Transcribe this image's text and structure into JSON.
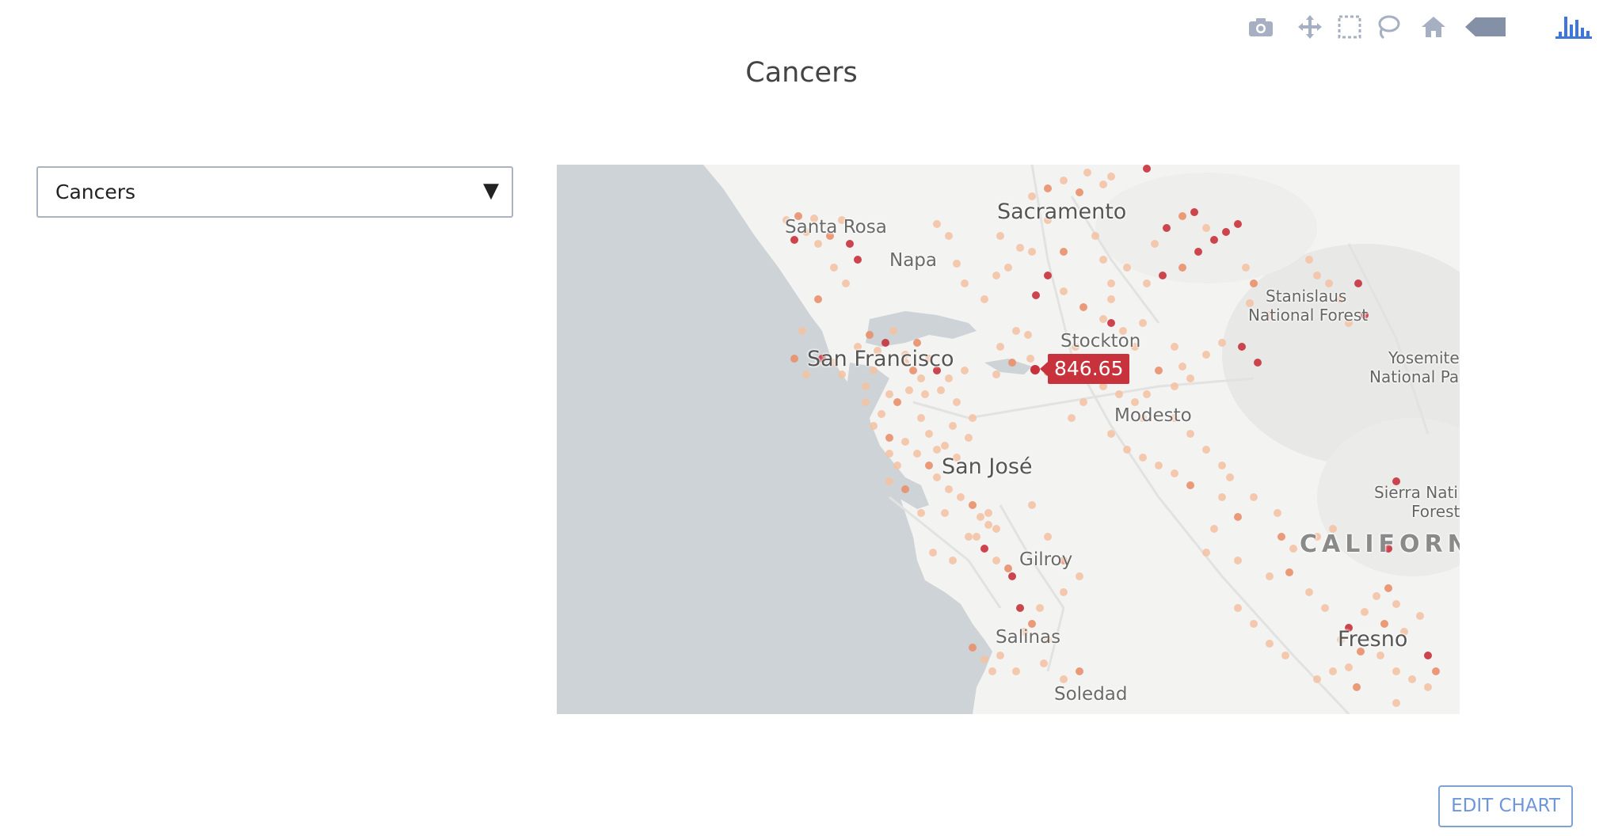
{
  "title": "Cancers",
  "dropdown": {
    "selected": "Cancers"
  },
  "modebar": {
    "buttons": [
      "camera-icon",
      "pan-icon",
      "box-select-icon",
      "lasso-icon",
      "home-icon",
      "toggle-hover-icon",
      "plotly-logo-icon"
    ],
    "icon_color": "#a6b0c2",
    "logo_color": "#3f76d9"
  },
  "map": {
    "places": {
      "sacramento": "Sacramento",
      "santa_rosa": "Santa Rosa",
      "napa": "Napa",
      "stanislaus": "Stanislaus",
      "stanislaus_nf": "National Forest",
      "stockton": "Stockton",
      "san_francisco": "San Francisco",
      "yosemite": "Yosemite",
      "yosemite_np": "National Pa",
      "modesto": "Modesto",
      "san_jose": "San José",
      "sierra": "Sierra Nati",
      "sierra_forest": "Forest",
      "california": "CALIFORNI",
      "gilroy": "Gilroy",
      "fresno": "Fresno",
      "salinas": "Salinas",
      "soledad": "Soledad"
    },
    "colors": {
      "low": "#f3c3a5",
      "mid": "#e9906a",
      "high": "#c8323c",
      "ocean": "#cdd3d6",
      "land": "#f3f3f1"
    }
  },
  "hover": {
    "value": "846.65"
  },
  "edit_button": {
    "label": "EDIT CHART"
  }
}
